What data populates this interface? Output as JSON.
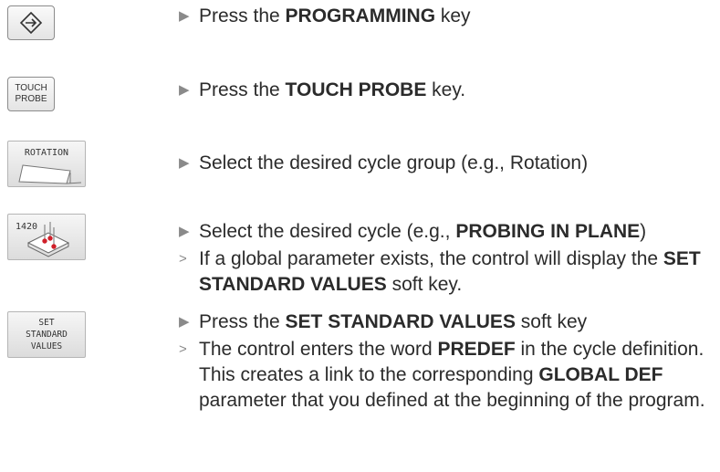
{
  "keys": {
    "programming_icon": "programming-arrow-icon",
    "touch_probe": {
      "line1": "TOUCH",
      "line2": "PROBE"
    }
  },
  "softkeys": {
    "rotation": "ROTATION",
    "cycle_1420": "1420",
    "set_standard": {
      "line1": "SET",
      "line2": "STANDARD",
      "line3": "VALUES"
    }
  },
  "steps": [
    {
      "marker": "▶",
      "pre": "Press the ",
      "bold": "PROGRAMMING",
      "post": " key"
    },
    {
      "marker": "▶",
      "pre": "Press the ",
      "bold": "TOUCH PROBE",
      "post": " key."
    },
    {
      "marker": "▶",
      "pre": "Select the desired cycle group (e.g., Rotation)",
      "bold": "",
      "post": ""
    },
    {
      "marker": "▶",
      "pre": "Select the desired cycle (e.g., ",
      "bold": "PROBING IN PLANE",
      "post": ")"
    },
    {
      "marker": ">",
      "pre": "If a global parameter exists, the control will display the ",
      "bold": "SET STANDARD VALUES",
      "post": " soft key."
    },
    {
      "marker": "▶",
      "pre": "Press the ",
      "bold": "SET STANDARD VALUES",
      "post": " soft key"
    },
    {
      "marker": ">",
      "pre": "The control enters the word ",
      "bold": "PREDEF",
      "post": " in the cycle definition. This creates a link to the corresponding ",
      "bold2": "GLOBAL DEF",
      "post2": " parameter that you defined at the beginning of the program."
    }
  ],
  "colors": {
    "marker": "#8a8a8a",
    "text": "#2b2b2b",
    "key_border": "#8c8c8c"
  }
}
